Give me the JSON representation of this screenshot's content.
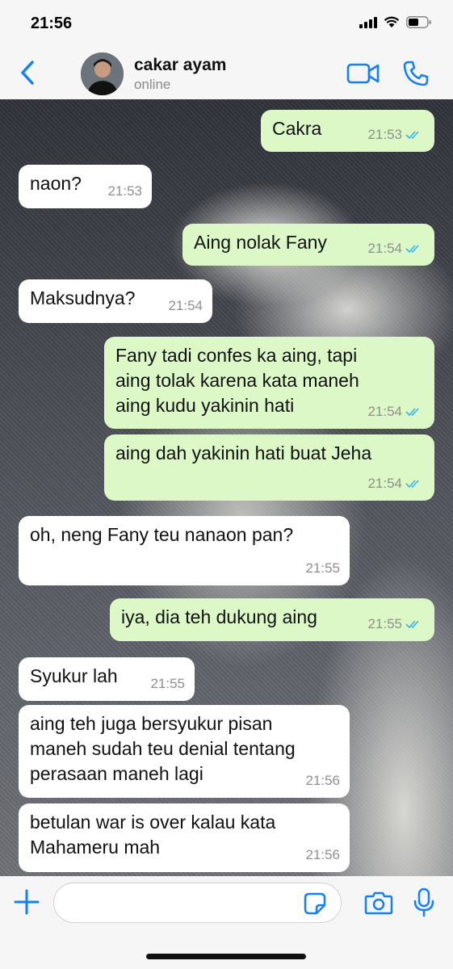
{
  "status_bar": {
    "time": "21:56"
  },
  "header": {
    "contact_name": "cakar ayam",
    "contact_status": "online"
  },
  "messages": [
    {
      "direction": "out",
      "text": "Cakra",
      "time": "21:53",
      "read": true
    },
    {
      "direction": "in",
      "text": "naon?",
      "time": "21:53"
    },
    {
      "direction": "out",
      "text": "Aing nolak Fany",
      "time": "21:54",
      "read": true
    },
    {
      "direction": "in",
      "text": "Maksudnya?",
      "time": "21:54"
    },
    {
      "direction": "out",
      "text": "Fany tadi confes ka aing, tapi\naing tolak karena kata maneh\naing kudu yakinin hati",
      "time": "21:54",
      "read": true
    },
    {
      "direction": "out",
      "text": "aing dah yakinin hati buat Jeha",
      "time": "21:54",
      "read": true
    },
    {
      "direction": "in",
      "text": "oh, neng Fany teu nanaon pan?",
      "time": "21:55"
    },
    {
      "direction": "out",
      "text": "iya, dia teh dukung aing",
      "time": "21:55",
      "read": true
    },
    {
      "direction": "in",
      "text": "Syukur lah",
      "time": "21:55"
    },
    {
      "direction": "in",
      "text": "aing teh juga bersyukur pisan\nmaneh sudah teu denial tentang\nperasaan maneh lagi",
      "time": "21:56"
    },
    {
      "direction": "in",
      "text": "betulan war is over kalau kata\nMahameru mah",
      "time": "21:56"
    }
  ],
  "input": {
    "placeholder": ""
  },
  "colors": {
    "accent": "#147efb",
    "outgoing_bubble": "#dcf8c6",
    "incoming_bubble": "#ffffff",
    "read_ticks": "#34b7f1"
  },
  "icons": {
    "back": "chevron-left-icon",
    "video": "video-camera-icon",
    "call": "phone-icon",
    "plus": "plus-icon",
    "sticker": "sticker-icon",
    "camera": "camera-icon",
    "mic": "microphone-icon",
    "ticks": "double-check-icon"
  }
}
